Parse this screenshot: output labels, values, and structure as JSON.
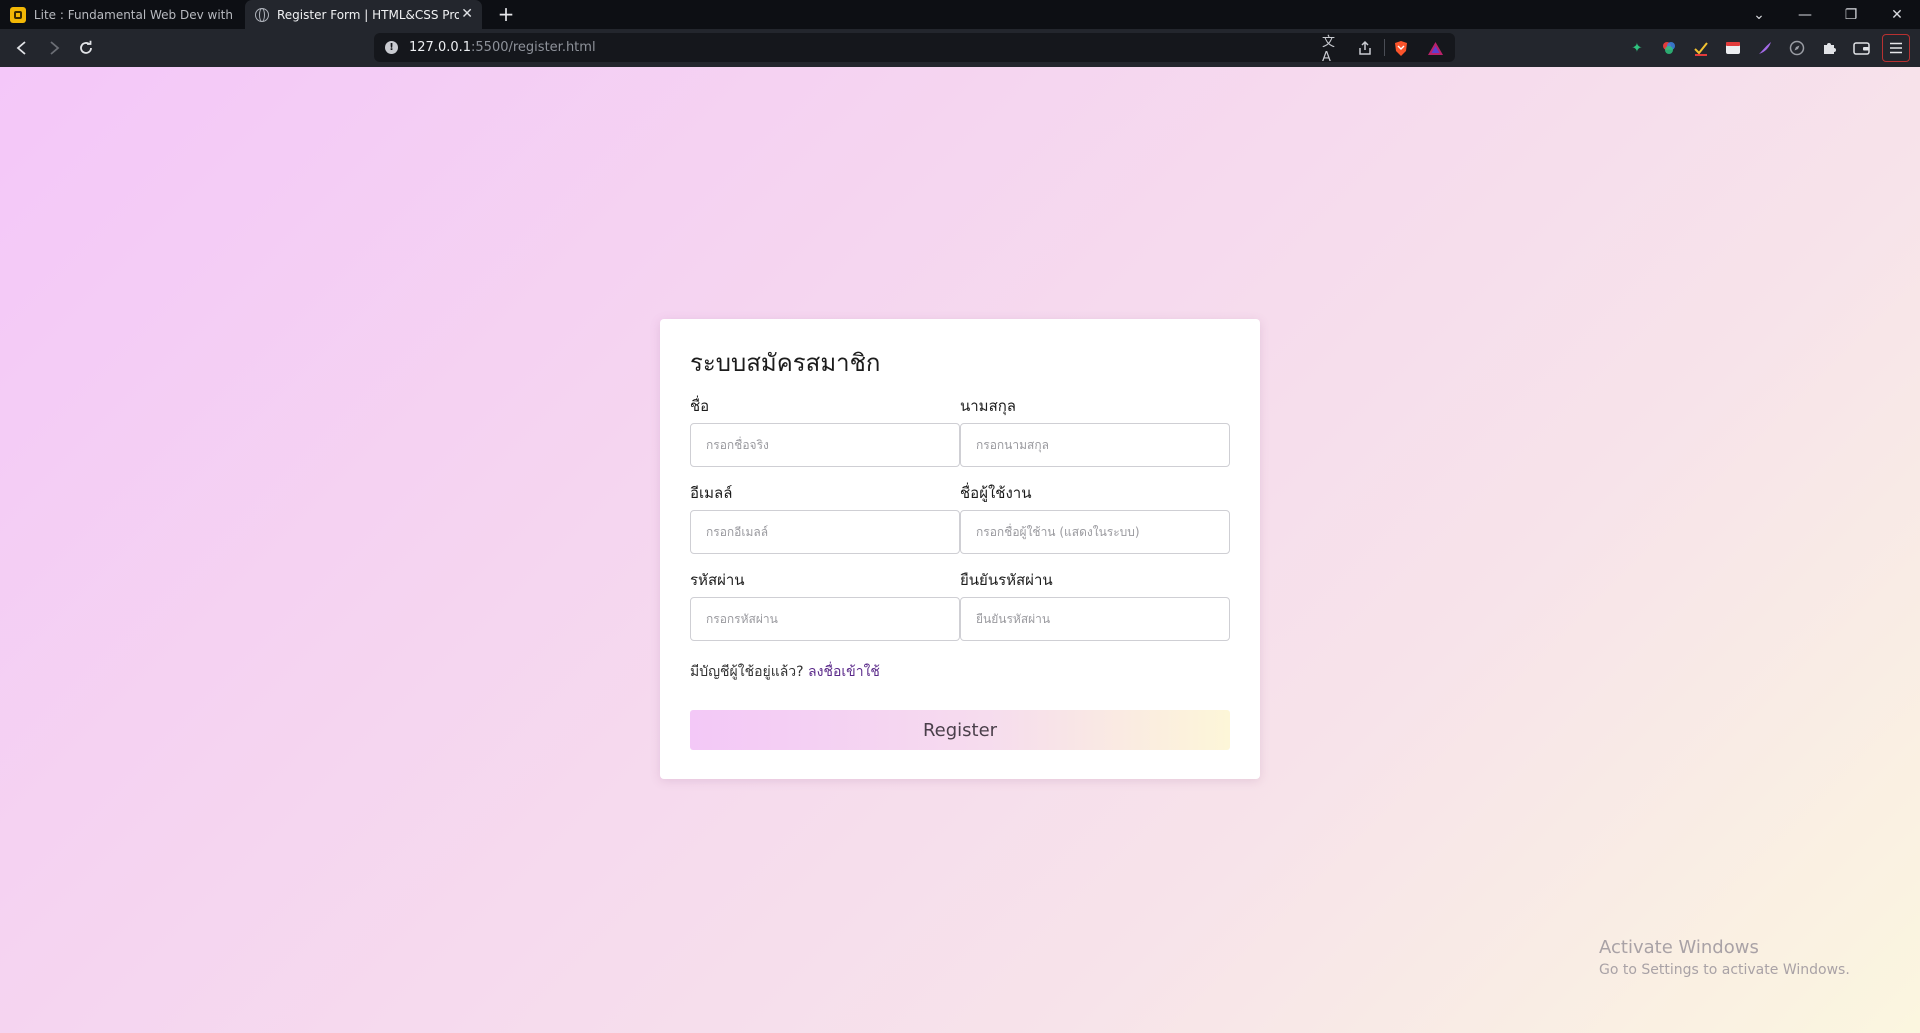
{
  "browser": {
    "tabs": [
      {
        "title": "Lite : Fundamental Web Dev with HTML",
        "active": false
      },
      {
        "title": "Register Form | HTML&CSS Project",
        "active": true
      }
    ],
    "new_tab": "+",
    "window_controls": {
      "dropdown": "⌄",
      "minimize": "—",
      "restore": "❐",
      "close": "✕"
    },
    "url": {
      "host": "127.0.0.1",
      "rest": ":5500/register.html"
    }
  },
  "form": {
    "title": "ระบบสมัครสมาชิก",
    "fields": {
      "first_name": {
        "label": "ชื่อ",
        "placeholder": "กรอกชื่อจริง"
      },
      "last_name": {
        "label": "นามสกุล",
        "placeholder": "กรอกนามสกุล"
      },
      "email": {
        "label": "อีเมลล์",
        "placeholder": "กรอกอีเมลล์"
      },
      "username": {
        "label": "ชื่อผู้ใช้งาน",
        "placeholder": "กรอกชื่อผู้ใช้าน (แสดงในระบบ)"
      },
      "password": {
        "label": "รหัสผ่าน",
        "placeholder": "กรอกรหัสผ่าน"
      },
      "confirm_password": {
        "label": "ยืนยันรหัสผ่าน",
        "placeholder": "ยืนยันรหัสผ่าน"
      }
    },
    "have_account_text": "มีบัญชีผู้ใช้อยู่แล้ว?",
    "login_link": "ลงชื่อเข้าใช้",
    "submit_label": "Register"
  },
  "watermark": {
    "line1": "Activate Windows",
    "line2": "Go to Settings to activate Windows."
  },
  "colors": {
    "accent_link": "#5b2a8a",
    "brave_shield": "#fb542b"
  }
}
